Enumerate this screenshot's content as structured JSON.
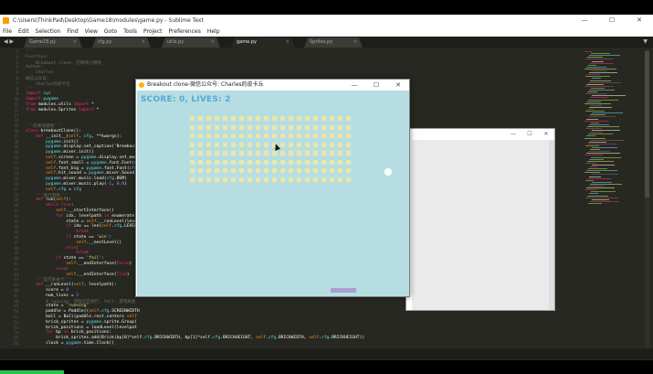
{
  "sublime": {
    "title": "C:\\Users\\ThinkPad\\Desktop\\Game18\\modules\\game.py - Sublime Text",
    "window_controls": [
      "—",
      "☐",
      "✕"
    ],
    "menu": [
      "File",
      "Edit",
      "Selection",
      "Find",
      "View",
      "Goto",
      "Tools",
      "Project",
      "Preferences",
      "Help"
    ],
    "tab_nav": "◀ ▶",
    "tabs": [
      {
        "label": "Game18.py"
      },
      {
        "label": "cfg.py"
      },
      {
        "label": "utils.py"
      },
      {
        "label": "game.py",
        "active": true
      },
      {
        "label": "Sprites.py"
      }
    ],
    "tab_close": "×",
    "tab_dropdown": "▼"
  },
  "code_lines": [
    "'''",
    "Function:",
    "    Breakout clone, 打砖块小游戏",
    "Author:",
    "    Charles",
    "微信公众号:",
    "    Charles的皮卡丘",
    "'''",
    "import sys",
    "import pygame",
    "from modules.utils import *",
    "from modules.Sprites import *",
    "",
    "",
    "'''打砖块游戏'''",
    "class breakoutClone():",
    "    def __init__(self, cfg, **kwargs):",
    "        pygame.init()",
    "        pygame.display.set_caption('Breakout",
    "        pygame.mixer.init()",
    "        self.screen = pygame.display.set_mode",
    "        self.font_small = pygame.font.Font(cf",
    "        self.font_big = pygame.font.Font(cfg.",
    "        self.hit_sound = pygame.mixer.Sound(c",
    "        pygame.mixer.music.load(cfg.BGM)",
    "        pygame.mixer.music.play(-1, 0.0)",
    "        self.cfg = cfg",
    "    '''运行游戏'''",
    "    def run(self):",
    "        while True:",
    "            self.__startInterface()",
    "            for idx, levelpath in enumerate(",
    "                state = self.__runLevel(leve",
    "                if idx == len(self.cfg.LEVEL",
    "                    break",
    "                if state == 'win':",
    "                    self.__nextLevel()",
    "                else:",
    "                    break",
    "            if state == 'fail':",
    "                self.__endInterface(False)",
    "            else:",
    "                self.__endInterface(True)",
    "    '''运行某关卡'''",
    "    def __runLevel(self, levelpath):",
    "        score = 0",
    "        num_lives = 2",
    "        # running: 游戏正在进行, fail: 游戏失败",
    "        state = 'running'",
    "        paddle = Paddle((self.cfg.SCREENWIDTH",
    "        ball = Ball(paddle.rect.centerx self",
    "        brick_sprites = pygame.sprite.Group(",
    "        brick_positions = loadLevel(levelpat",
    "        for bp in brick_positions:",
    "            brick_sprites.add(Brick(bp[0]*self.cfg.BRICKWIDTH, bp[1]*self.cfg.BRICKHEIGHT, self.cfg.BRICKWIDTH, self.cfg.BRICKHEIGHT))",
    "        clock = pygame.time.Clock()"
  ],
  "breakout": {
    "title": "Breakout clone-微信公众号: Charles的皮卡丘",
    "window_controls": [
      "—",
      "☐",
      "✕"
    ],
    "score_text": "SCORE: 0, LIVES: 2",
    "colors": {
      "background": "#b6dee2",
      "brick": "#eee5a6",
      "paddle": "#a9a0cf",
      "ball": "#ffffff",
      "score": "#5aa6d6"
    },
    "brick_grid": {
      "rows": 8,
      "cols": 20
    }
  },
  "second_window": {
    "window_controls": [
      "—",
      "☐",
      "✕"
    ]
  }
}
